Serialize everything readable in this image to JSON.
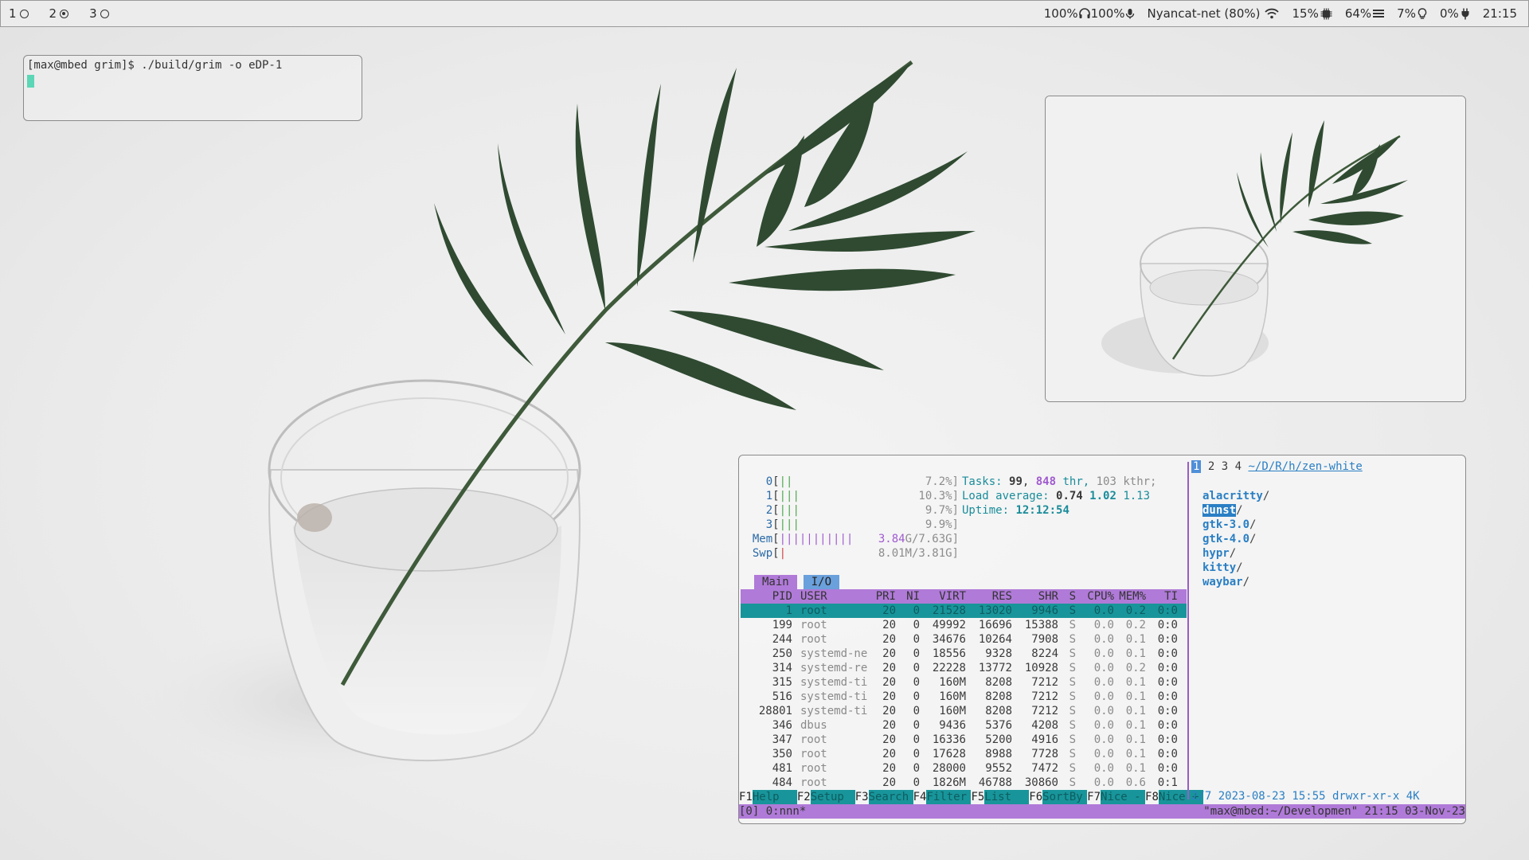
{
  "topbar": {
    "workspaces": [
      {
        "num": "1",
        "active": false
      },
      {
        "num": "2",
        "active": true
      },
      {
        "num": "3",
        "active": false
      }
    ],
    "audio_out": "100%",
    "audio_in": "100%",
    "network": "Nyancat-net (80%)",
    "cpu": "15%",
    "memory": "64%",
    "brightness": "7%",
    "battery": "0%",
    "clock": "21:15"
  },
  "terminal_small": {
    "prompt": "[max@mbed grim]$ ./build/grim -o eDP-1"
  },
  "htop": {
    "cpus": [
      {
        "id": "0",
        "bars": "||",
        "pct": "7.2%]"
      },
      {
        "id": "1",
        "bars": "|||",
        "pct": "10.3%]"
      },
      {
        "id": "2",
        "bars": "|||",
        "pct": "9.7%]"
      },
      {
        "id": "3",
        "bars": "|||",
        "pct": "9.9%]"
      }
    ],
    "mem_label": "Mem",
    "mem_bars": "|||||||||||",
    "mem_used": "3.84",
    "mem_total": "G/7.63G]",
    "swp_label": "Swp",
    "swp_bars": "|",
    "swp_value": "8.01M/3.81G]",
    "tasks_label": "Tasks:",
    "tasks": "99",
    "thr": "848",
    "thr_label": "thr,",
    "kthr": "103 kthr;",
    "load_label": "Load average:",
    "load1": "0.74",
    "load5": "1.02",
    "load15": "1.13",
    "uptime_label": "Uptime:",
    "uptime": "12:12:54",
    "tab_main": "Main",
    "tab_io": "I/O",
    "columns": [
      "PID",
      "USER",
      "PRI",
      "NI",
      "VIRT",
      "RES",
      "SHR",
      "S",
      "CPU%",
      "MEM%",
      "TI"
    ],
    "processes": [
      [
        "1",
        "root",
        "20",
        "0",
        "21528",
        "13020",
        "9946",
        "S",
        "0.0",
        "0.2",
        "0:0"
      ],
      [
        "199",
        "root",
        "20",
        "0",
        "49992",
        "16696",
        "15388",
        "S",
        "0.0",
        "0.2",
        "0:0"
      ],
      [
        "244",
        "root",
        "20",
        "0",
        "34676",
        "10264",
        "7908",
        "S",
        "0.0",
        "0.1",
        "0:0"
      ],
      [
        "250",
        "systemd-ne",
        "20",
        "0",
        "18556",
        "9328",
        "8224",
        "S",
        "0.0",
        "0.1",
        "0:0"
      ],
      [
        "314",
        "systemd-re",
        "20",
        "0",
        "22228",
        "13772",
        "10928",
        "S",
        "0.0",
        "0.2",
        "0:0"
      ],
      [
        "315",
        "systemd-ti",
        "20",
        "0",
        "160M",
        "8208",
        "7212",
        "S",
        "0.0",
        "0.1",
        "0:0"
      ],
      [
        "516",
        "systemd-ti",
        "20",
        "0",
        "160M",
        "8208",
        "7212",
        "S",
        "0.0",
        "0.1",
        "0:0"
      ],
      [
        "28801",
        "systemd-ti",
        "20",
        "0",
        "160M",
        "8208",
        "7212",
        "S",
        "0.0",
        "0.1",
        "0:0"
      ],
      [
        "346",
        "dbus",
        "20",
        "0",
        "9436",
        "5376",
        "4208",
        "S",
        "0.0",
        "0.1",
        "0:0"
      ],
      [
        "347",
        "root",
        "20",
        "0",
        "16336",
        "5200",
        "4916",
        "S",
        "0.0",
        "0.1",
        "0:0"
      ],
      [
        "350",
        "root",
        "20",
        "0",
        "17628",
        "8988",
        "7728",
        "S",
        "0.0",
        "0.1",
        "0:0"
      ],
      [
        "481",
        "root",
        "20",
        "0",
        "28000",
        "9552",
        "7472",
        "S",
        "0.0",
        "0.1",
        "0:0"
      ],
      [
        "484",
        "root",
        "20",
        "0",
        "1826M",
        "46788",
        "30860",
        "S",
        "0.0",
        "0.6",
        "0:1"
      ]
    ],
    "fkeys": [
      {
        "key": "F1",
        "label": "Help"
      },
      {
        "key": "F2",
        "label": "Setup"
      },
      {
        "key": "F3",
        "label": "Search"
      },
      {
        "key": "F4",
        "label": "Filter"
      },
      {
        "key": "F5",
        "label": "List"
      },
      {
        "key": "F6",
        "label": "SortBy"
      },
      {
        "key": "F7",
        "label": "Nice -"
      },
      {
        "key": "F8",
        "label": "Nice +"
      }
    ]
  },
  "nnn": {
    "contexts": [
      "1",
      "2",
      "3",
      "4"
    ],
    "path": "~/D/R/h/zen-white",
    "entries": [
      "alacritty",
      "dunst",
      "gtk-3.0",
      "gtk-4.0",
      "hypr",
      "kitty",
      "waybar"
    ],
    "current_index": 1,
    "status": "2/7 2023-08-23 15:55 drwxr-xr-x 4K"
  },
  "tmux": {
    "left": "[0] 0:nnn*",
    "right": "\"max@mbed:~/Developmen\" 21:15 03-Nov-23"
  }
}
